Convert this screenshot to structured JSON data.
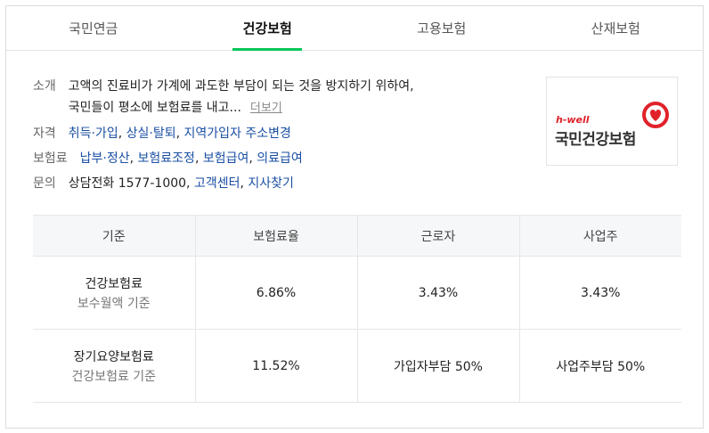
{
  "tabs": [
    "국민연금",
    "건강보험",
    "고용보험",
    "산재보험"
  ],
  "active_tab": 1,
  "info": {
    "intro": {
      "label": "소개",
      "text_line1": "고액의 진료비가 가계에 과도한 부담이 되는 것을 방지하기 위하여,",
      "text_line2": "국민들이 평소에 보험료를 내고...",
      "more": "더보기"
    },
    "qualification": {
      "label": "자격",
      "links": [
        "취득·가입",
        "상실·탈퇴",
        "지역가입자 주소변경"
      ]
    },
    "premium": {
      "label": "보험료",
      "links": [
        "납부·정산",
        "보험료조정",
        "보험급여",
        "의료급여"
      ]
    },
    "contact": {
      "label": "문의",
      "text": "상담전화 1577-1000,",
      "links": [
        "고객센터",
        "지사찾기"
      ]
    }
  },
  "logo": {
    "brand": "h-well",
    "name": "국민건강보험",
    "accent": "#e0222a"
  },
  "table": {
    "headers": [
      "기준",
      "보험료율",
      "근로자",
      "사업주"
    ],
    "rows": [
      {
        "name": "건강보험료",
        "sub": "보수월액 기준",
        "rate": "6.86%",
        "worker": "3.43%",
        "employer": "3.43%"
      },
      {
        "name": "장기요양보험료",
        "sub": "건강보험료 기준",
        "rate": "11.52%",
        "worker": "가입자부담 50%",
        "employer": "사업주부담 50%"
      }
    ]
  },
  "colors": {
    "accent_green": "#03c75a",
    "link_blue": "#1a4fa3"
  }
}
